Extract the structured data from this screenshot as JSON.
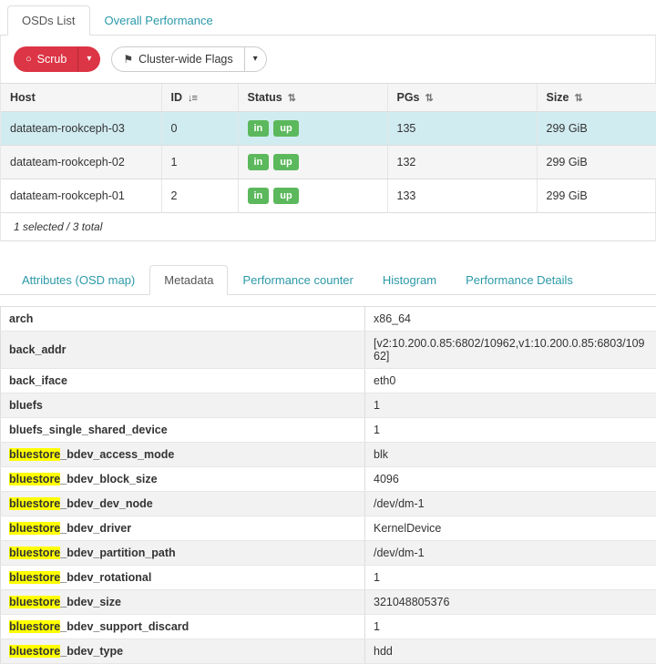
{
  "colors": {
    "accent": "#2b99a8",
    "danger": "#dc3545",
    "badge": "#5cb85c",
    "selected": "#d1ecf1",
    "highlight": "#ffff00"
  },
  "icons": {
    "scrub": "○",
    "flag": "⚑",
    "caret_down": "▾",
    "sort_active": "↓≡",
    "sort_both": "⇅"
  },
  "top_tabs": [
    {
      "label": "OSDs List",
      "active": true
    },
    {
      "label": "Overall Performance",
      "active": false
    }
  ],
  "toolbar": {
    "scrub_label": "Scrub",
    "flags_label": "Cluster-wide Flags"
  },
  "osd_table": {
    "columns": [
      {
        "label": "Host",
        "sort": null
      },
      {
        "label": "ID",
        "sort": "active"
      },
      {
        "label": "Status",
        "sort": "both"
      },
      {
        "label": "PGs",
        "sort": "both"
      },
      {
        "label": "Size",
        "sort": "both"
      }
    ],
    "rows": [
      {
        "host": "datateam-rookceph-03",
        "id": "0",
        "status": [
          "in",
          "up"
        ],
        "pgs": "135",
        "size": "299 GiB",
        "selected": true
      },
      {
        "host": "datateam-rookceph-02",
        "id": "1",
        "status": [
          "in",
          "up"
        ],
        "pgs": "132",
        "size": "299 GiB",
        "selected": false
      },
      {
        "host": "datateam-rookceph-01",
        "id": "2",
        "status": [
          "in",
          "up"
        ],
        "pgs": "133",
        "size": "299 GiB",
        "selected": false
      }
    ],
    "footer": "1 selected / 3 total"
  },
  "detail_tabs": [
    {
      "label": "Attributes (OSD map)",
      "active": false
    },
    {
      "label": "Metadata",
      "active": true
    },
    {
      "label": "Performance counter",
      "active": false
    },
    {
      "label": "Histogram",
      "active": false
    },
    {
      "label": "Performance Details",
      "active": false
    }
  ],
  "metadata": {
    "highlight": "bluestore",
    "rows": [
      {
        "key": "arch",
        "value": "x86_64"
      },
      {
        "key": "back_addr",
        "value": "[v2:10.200.0.85:6802/10962,v1:10.200.0.85:6803/10962]"
      },
      {
        "key": "back_iface",
        "value": "eth0"
      },
      {
        "key": "bluefs",
        "value": "1"
      },
      {
        "key": "bluefs_single_shared_device",
        "value": "1"
      },
      {
        "key": "bluestore_bdev_access_mode",
        "value": "blk"
      },
      {
        "key": "bluestore_bdev_block_size",
        "value": "4096"
      },
      {
        "key": "bluestore_bdev_dev_node",
        "value": "/dev/dm-1"
      },
      {
        "key": "bluestore_bdev_driver",
        "value": "KernelDevice"
      },
      {
        "key": "bluestore_bdev_partition_path",
        "value": "/dev/dm-1"
      },
      {
        "key": "bluestore_bdev_rotational",
        "value": "1"
      },
      {
        "key": "bluestore_bdev_size",
        "value": "321048805376"
      },
      {
        "key": "bluestore_bdev_support_discard",
        "value": "1"
      },
      {
        "key": "bluestore_bdev_type",
        "value": "hdd"
      }
    ]
  }
}
